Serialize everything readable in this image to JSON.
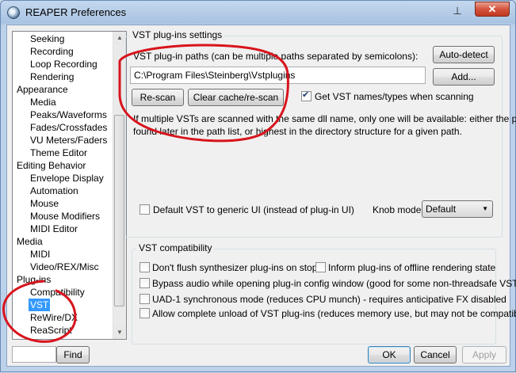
{
  "window": {
    "title": "REAPER Preferences",
    "pin_glyph": "⊥",
    "close_glyph": "✕"
  },
  "sidebar": {
    "items": [
      {
        "label": "Seeking",
        "level": 1
      },
      {
        "label": "Recording",
        "level": 1
      },
      {
        "label": "Loop Recording",
        "level": 1
      },
      {
        "label": "Rendering",
        "level": 1
      },
      {
        "label": "Appearance",
        "level": 0
      },
      {
        "label": "Media",
        "level": 1
      },
      {
        "label": "Peaks/Waveforms",
        "level": 1
      },
      {
        "label": "Fades/Crossfades",
        "level": 1
      },
      {
        "label": "VU Meters/Faders",
        "level": 1
      },
      {
        "label": "Theme Editor",
        "level": 1
      },
      {
        "label": "Editing Behavior",
        "level": 0
      },
      {
        "label": "Envelope Display",
        "level": 1
      },
      {
        "label": "Automation",
        "level": 1
      },
      {
        "label": "Mouse",
        "level": 1
      },
      {
        "label": "Mouse Modifiers",
        "level": 1
      },
      {
        "label": "MIDI Editor",
        "level": 1
      },
      {
        "label": "Media",
        "level": 0
      },
      {
        "label": "MIDI",
        "level": 1
      },
      {
        "label": "Video/REX/Misc",
        "level": 1
      },
      {
        "label": "Plug-ins",
        "level": 0
      },
      {
        "label": "Compatibility",
        "level": 1
      },
      {
        "label": "VST",
        "level": 1,
        "selected": true
      },
      {
        "label": "ReWire/DX",
        "level": 1
      },
      {
        "label": "ReaScript",
        "level": 1
      }
    ],
    "search_value": "",
    "find_label": "Find"
  },
  "vst_settings": {
    "group_title": "VST plug-ins settings",
    "paths_label": "VST plug-in paths (can be multiple paths separated by semicolons):",
    "paths_value": "C:\\Program Files\\Steinberg\\Vstplugins",
    "auto_detect_label": "Auto-detect",
    "add_label": "Add...",
    "rescan_label": "Re-scan",
    "clear_cache_label": "Clear cache/re-scan",
    "get_names_label": "Get VST names/types when scanning",
    "get_names_checked": true,
    "info_line1": "If multiple VSTs are scanned with the same dll name, only one will be available: either the plugin",
    "info_line2": "found later in the path list, or highest in the directory structure for a given path.",
    "default_generic_ui_label": "Default VST to generic UI (instead of plug-in UI)",
    "default_generic_ui_checked": false,
    "knob_mode_label": "Knob mode:",
    "knob_mode_value": "Default"
  },
  "vst_compat": {
    "group_title": "VST compatibility",
    "options": [
      {
        "label": "Don't flush synthesizer plug-ins on stop",
        "checked": false
      },
      {
        "label": "Inform plug-ins of offline rendering state",
        "checked": false
      },
      {
        "label": "Bypass audio while opening plug-in config window (good for some non-threadsafe VSTs)",
        "checked": false
      },
      {
        "label": "UAD-1 synchronous mode (reduces CPU munch) - requires anticipative FX disabled",
        "checked": false
      },
      {
        "label": "Allow complete unload of VST plug-ins (reduces memory use, but may not be compatible)",
        "checked": false
      }
    ]
  },
  "footer": {
    "ok_label": "OK",
    "cancel_label": "Cancel",
    "apply_label": "Apply"
  },
  "colors": {
    "selection": "#3399ff",
    "annotation": "#d8141d",
    "close_button": "#c7432c"
  }
}
